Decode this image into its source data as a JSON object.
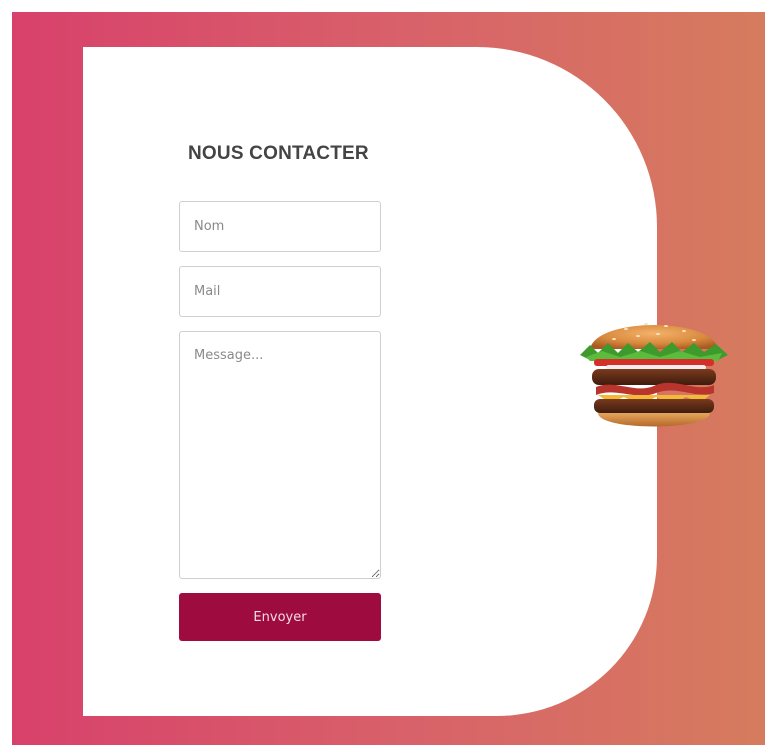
{
  "form": {
    "title": "NOUS CONTACTER",
    "name_placeholder": "Nom",
    "mail_placeholder": "Mail",
    "message_placeholder": "Message...",
    "submit_label": "Envoyer"
  },
  "decor": {
    "image": "burger-image"
  },
  "colors": {
    "gradient_start": "#d8416b",
    "gradient_end": "#d67c5e",
    "button": "#9e0b3f",
    "title": "#444444"
  }
}
